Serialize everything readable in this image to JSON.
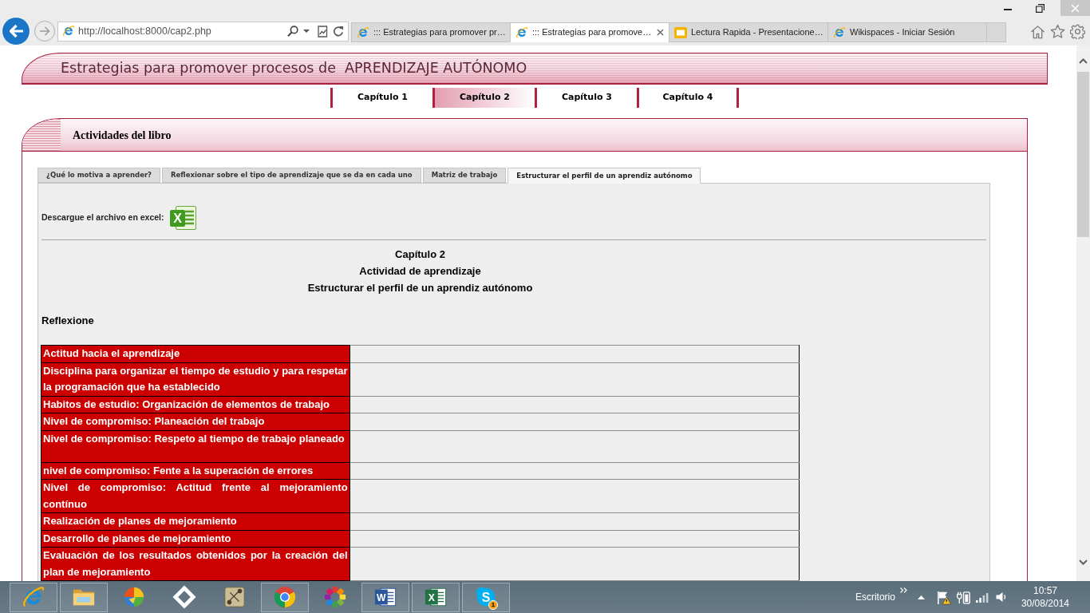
{
  "browser": {
    "address": "http://localhost:8000/cap2.php",
    "tabs": [
      {
        "kind": "web",
        "title": "::: Estrategias para promover pr…",
        "selected": false
      },
      {
        "kind": "web",
        "title": "::: Estrategias para promove…",
        "selected": true
      },
      {
        "kind": "slides",
        "title": "Lectura Rapida - Presentacione…",
        "selected": false
      },
      {
        "kind": "web",
        "title": "Wikispaces - Iniciar Sesión",
        "selected": false
      }
    ]
  },
  "page": {
    "title": "Estrategias para promover procesos de  APRENDIZAJE AUTÓNOMO",
    "chapters": [
      {
        "label": "Capítulo 1",
        "selected": false
      },
      {
        "label": "Capítulo 2",
        "selected": true
      },
      {
        "label": "Capítulo 3",
        "selected": false
      },
      {
        "label": "Capítulo 4",
        "selected": false
      }
    ],
    "panel_title": "Actividades del libro",
    "activity_tabs": [
      {
        "label": "¿Qué lo motiva a aprender?",
        "selected": false
      },
      {
        "label": "Reflexionar sobre el tipo de aprendizaje que se da en cada uno",
        "selected": false
      },
      {
        "label": "Matriz de trabajo",
        "selected": false
      },
      {
        "label": "Estructurar el perfil de un aprendiz autónomo",
        "selected": true
      }
    ],
    "download_label": "Descargue el archivo en excel:",
    "download_icon_glyph": "X",
    "headings": [
      "Capítulo 2",
      "Actividad de aprendizaje",
      "Estructurar el perfil de un aprendiz autónomo"
    ],
    "section_label": "Reflexione",
    "table": {
      "rows": [
        "Actitud hacia el aprendizaje",
        "Disciplina para organizar el tiempo de estudio y para respetar la programación que ha establecido",
        "Habitos de estudio: Organización de elementos de trabajo",
        "Nivel de compromiso: Planeación del trabajo",
        "Nivel de compromiso: Respeto al tiempo de trabajo planeado",
        "nivel de compromiso: Fente a la superación de errores",
        "Nivel de compromiso: Actitud frente al mejoramiento contínuo",
        "Realización de planes de mejoramiento",
        "Desarrollo de planes de mejoramiento",
        "Evaluación de los resultados obtenidos por la creación del plan de mejoramiento"
      ]
    }
  },
  "taskbar": {
    "apps": [
      {
        "kind": "ie",
        "running": true
      },
      {
        "kind": "folder",
        "running": true
      },
      {
        "kind": "orb",
        "running": false
      },
      {
        "kind": "diamond",
        "running": false
      },
      {
        "kind": "map",
        "running": false
      },
      {
        "kind": "chrome",
        "running": true
      },
      {
        "kind": "flower",
        "running": false
      },
      {
        "kind": "word",
        "glyph": "W",
        "running": true
      },
      {
        "kind": "excel",
        "glyph": "X",
        "running": true
      },
      {
        "kind": "skype",
        "glyph": "S",
        "badge": "1",
        "running": true
      }
    ],
    "tray": {
      "label": "Escritorio",
      "time": "10:57",
      "date": "30/08/2014"
    }
  }
}
